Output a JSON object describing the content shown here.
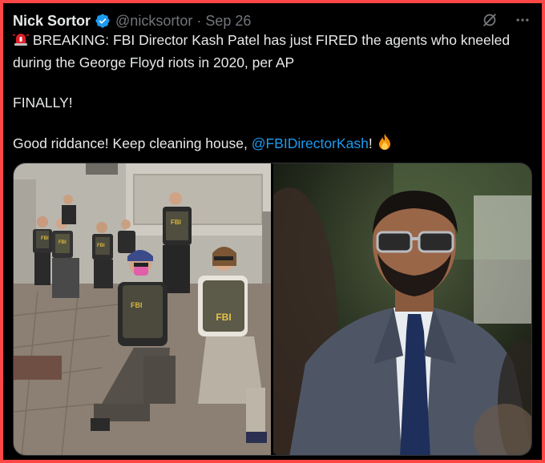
{
  "tweet": {
    "author_name": "Nick Sortor",
    "handle": "@nicksortor",
    "separator": "·",
    "date": "Sep 26",
    "line1": " BREAKING: FBI Director Kash Patel has just FIRED the agents who kneeled during the George Floyd riots in 2020, per AP",
    "line2": "FINALLY!",
    "line3_start": "Good riddance! Keep cleaning house, ",
    "mention": "@FBIDirectorKash",
    "line3_end": "! "
  },
  "icons": {
    "verified": "verified-badge-icon",
    "grok": "grok-icon",
    "more": "more-options-icon",
    "siren": "siren-emoji",
    "fire": "fire-emoji"
  },
  "colors": {
    "border": "#ff4747",
    "background": "#000000",
    "text": "#e7e9ea",
    "muted": "#71767b",
    "link": "#1d9bf0"
  },
  "media": {
    "left_photo_vest_text": [
      "FBI",
      "FBI",
      "FBI",
      "FBI",
      "FBI",
      "FBI"
    ]
  }
}
